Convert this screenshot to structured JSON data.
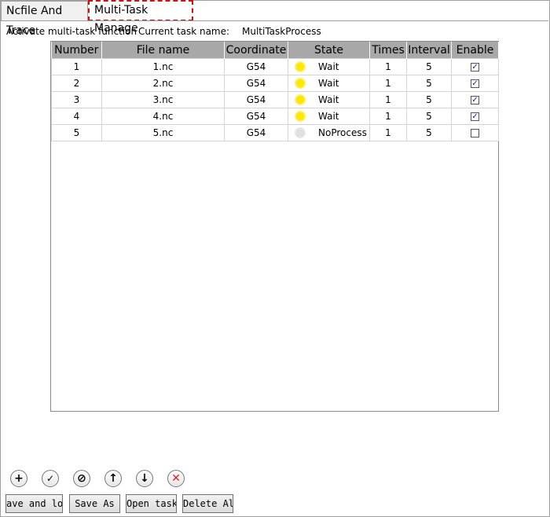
{
  "tabs": [
    "Ncfile And Trace",
    "Multi-Task Manage"
  ],
  "info": {
    "activate_label": "Activate multi-task function",
    "current_task_label": "Current task name:",
    "current_task_value": "MultiTaskProcess"
  },
  "table": {
    "headers": [
      "Number",
      "File name",
      "Coordinate",
      "State",
      "Times",
      "Interval",
      "Enable"
    ],
    "rows": [
      {
        "number": "1",
        "file": "1.nc",
        "coord": "G54",
        "state": "Wait",
        "times": "1",
        "interval": "5",
        "enabled": true
      },
      {
        "number": "2",
        "file": "2.nc",
        "coord": "G54",
        "state": "Wait",
        "times": "1",
        "interval": "5",
        "enabled": true
      },
      {
        "number": "3",
        "file": "3.nc",
        "coord": "G54",
        "state": "Wait",
        "times": "1",
        "interval": "5",
        "enabled": true
      },
      {
        "number": "4",
        "file": "4.nc",
        "coord": "G54",
        "state": "Wait",
        "times": "1",
        "interval": "5",
        "enabled": true
      },
      {
        "number": "5",
        "file": "5.nc",
        "coord": "G54",
        "state": "NoProcess",
        "times": "1",
        "interval": "5",
        "enabled": false
      }
    ]
  },
  "icon_buttons": [
    "add-icon",
    "check-icon",
    "disable-icon",
    "move-up-icon",
    "move-down-icon",
    "delete-icon"
  ],
  "colors": {
    "wait": "#ffe800",
    "noprocess": "#e0e0e0",
    "delete": "#e02020",
    "header_bg": "#a8a8a8",
    "tab_highlight": "#d01010"
  },
  "buttons": {
    "save_load": "ave and loa",
    "save_as": "Save As",
    "open_task": "Open task",
    "delete_all": "Delete All"
  }
}
